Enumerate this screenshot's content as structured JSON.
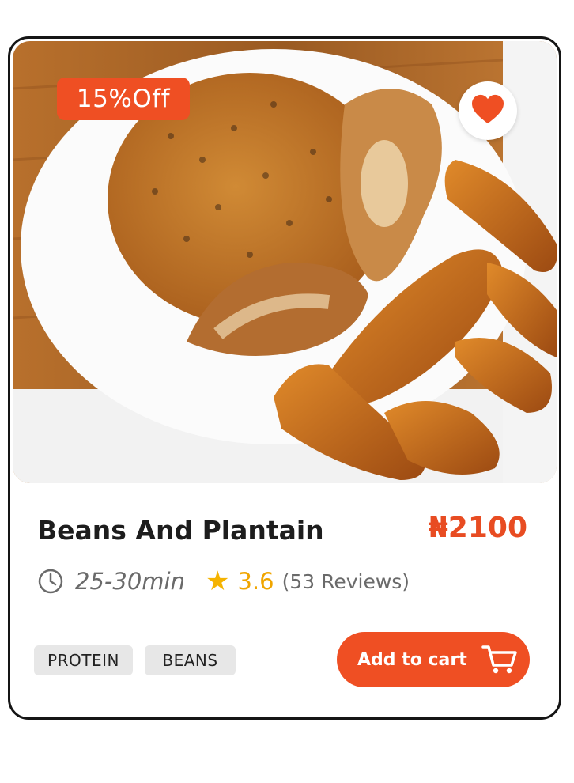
{
  "product": {
    "badge": "15%Off",
    "name": "Beans And Plantain",
    "price": "₦2100",
    "time": "25-30min",
    "rating": "3.6",
    "reviews": "(53 Reviews)",
    "tags": [
      "PROTEIN",
      "BEANS"
    ],
    "add_to_cart": "Add to cart",
    "favorited": true
  },
  "icons": {
    "favorite": "heart-icon",
    "time": "clock-icon",
    "rating": "star-icon",
    "cart": "shopping-cart-icon"
  },
  "colors": {
    "accent": "#ef4f23",
    "price": "#e84c22",
    "star": "#f5b300",
    "tag_bg": "#e7e7e7",
    "border": "#151515"
  }
}
